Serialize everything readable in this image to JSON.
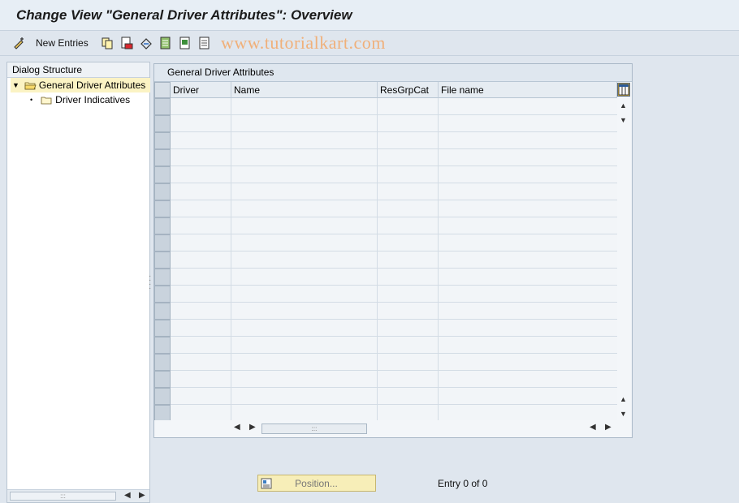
{
  "window": {
    "title": "Change View \"General Driver Attributes\": Overview"
  },
  "toolbar": {
    "new_entries_label": "New Entries",
    "watermark": "www.tutorialkart.com",
    "icons": [
      "display-change-icon",
      "copy-icon",
      "delete-icon",
      "undo-icon",
      "select-all-icon",
      "select-block-icon",
      "deselect-all-icon"
    ]
  },
  "dialog_structure": {
    "header": "Dialog Structure",
    "items": [
      {
        "label": "General Driver Attributes",
        "selected": true,
        "expanded": true
      },
      {
        "label": "Driver Indicatives",
        "selected": false
      }
    ]
  },
  "table": {
    "title": "General Driver Attributes",
    "columns": [
      "Driver",
      "Name",
      "ResGrpCat",
      "File name"
    ],
    "row_count": 19
  },
  "footer": {
    "position_label": "Position...",
    "entry_text": "Entry 0 of 0"
  },
  "colors": {
    "background": "#dfe6ee",
    "selected_tree": "#fbf3c4",
    "position_button": "#f7eeb8",
    "watermark": "#f0b07a"
  }
}
